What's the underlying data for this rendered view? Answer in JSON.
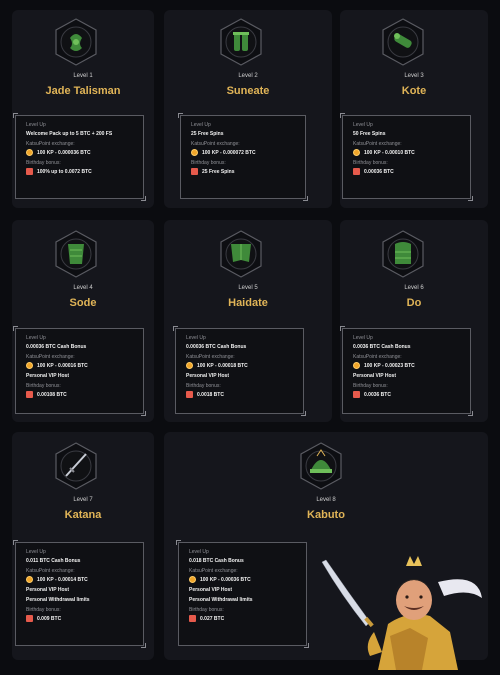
{
  "labels": {
    "level_up": "Level Up",
    "exchange": "KatsuPoint exchange:",
    "birthday": "Birthday bonus:"
  },
  "levels": [
    {
      "level": "Level 1",
      "name": "Jade Talisman",
      "icon": "jade-talisman-icon",
      "perks": [
        "Welcome Pack up to 5 BTC + 200 FS"
      ],
      "exchange": "100 KP - 0.000036 BTC",
      "birthday": "100% up to 0.0072 BTC"
    },
    {
      "level": "Level 2",
      "name": "Suneate",
      "icon": "suneate-icon",
      "perks": [
        "25 Free Spins"
      ],
      "exchange": "100 KP - 0.000072 BTC",
      "birthday": "25 Free Spins"
    },
    {
      "level": "Level 3",
      "name": "Kote",
      "icon": "kote-icon",
      "perks": [
        "50 Free Spins"
      ],
      "exchange": "100 KP - 0.00010 BTC",
      "birthday": "0.00036 BTC"
    },
    {
      "level": "Level 4",
      "name": "Sode",
      "icon": "sode-icon",
      "perks": [
        "0.00036 BTC Cash Bonus",
        "Personal VIP Host"
      ],
      "exchange": "100 KP - 0.00016 BTC",
      "birthday": "0.00108 BTC"
    },
    {
      "level": "Level 5",
      "name": "Haidate",
      "icon": "haidate-icon",
      "perks": [
        "0.00036 BTC Cash Bonus",
        "Personal VIP Host"
      ],
      "exchange": "100 KP - 0.00018 BTC",
      "birthday": "0.0018 BTC"
    },
    {
      "level": "Level 6",
      "name": "Do",
      "icon": "do-icon",
      "perks": [
        "0.0036 BTC Cash Bonus",
        "Personal VIP Host"
      ],
      "exchange": "100 KP - 0.00023 BTC",
      "birthday": "0.0036 BTC"
    },
    {
      "level": "Level 7",
      "name": "Katana",
      "icon": "katana-icon",
      "perks": [
        "0.011 BTC Cash Bonus",
        "Personal VIP Host",
        "Personal Withdrawal limits"
      ],
      "exchange": "100 KP - 0.00014 BTC",
      "birthday": "0.009 BTC"
    },
    {
      "level": "Level 8",
      "name": "Kabuto",
      "icon": "kabuto-icon",
      "perks": [
        "0.018 BTC Cash Bonus",
        "Personal VIP Host",
        "Personal Withdrawal limits"
      ],
      "exchange": "100 KP - 0.00036 BTC",
      "birthday": "0.027 BTC"
    }
  ],
  "colors": {
    "accent": "#e0b457",
    "coin": "#f0a52a",
    "gift": "#e65a4c",
    "card": "#15161c",
    "background": "#0b0c10"
  }
}
